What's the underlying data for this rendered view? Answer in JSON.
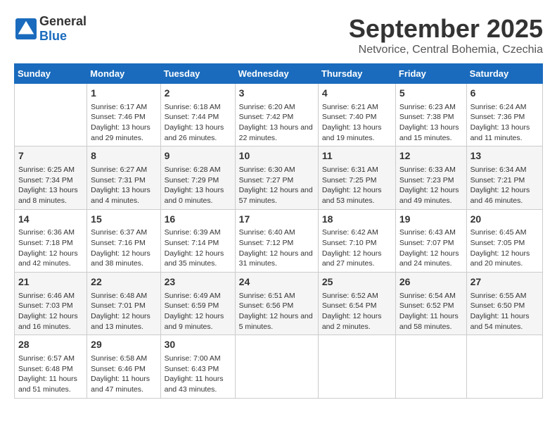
{
  "header": {
    "logo_general": "General",
    "logo_blue": "Blue",
    "month": "September 2025",
    "location": "Netvorice, Central Bohemia, Czechia"
  },
  "days_of_week": [
    "Sunday",
    "Monday",
    "Tuesday",
    "Wednesday",
    "Thursday",
    "Friday",
    "Saturday"
  ],
  "weeks": [
    [
      {
        "day": "",
        "sunrise": "",
        "sunset": "",
        "daylight": ""
      },
      {
        "day": "1",
        "sunrise": "Sunrise: 6:17 AM",
        "sunset": "Sunset: 7:46 PM",
        "daylight": "Daylight: 13 hours and 29 minutes."
      },
      {
        "day": "2",
        "sunrise": "Sunrise: 6:18 AM",
        "sunset": "Sunset: 7:44 PM",
        "daylight": "Daylight: 13 hours and 26 minutes."
      },
      {
        "day": "3",
        "sunrise": "Sunrise: 6:20 AM",
        "sunset": "Sunset: 7:42 PM",
        "daylight": "Daylight: 13 hours and 22 minutes."
      },
      {
        "day": "4",
        "sunrise": "Sunrise: 6:21 AM",
        "sunset": "Sunset: 7:40 PM",
        "daylight": "Daylight: 13 hours and 19 minutes."
      },
      {
        "day": "5",
        "sunrise": "Sunrise: 6:23 AM",
        "sunset": "Sunset: 7:38 PM",
        "daylight": "Daylight: 13 hours and 15 minutes."
      },
      {
        "day": "6",
        "sunrise": "Sunrise: 6:24 AM",
        "sunset": "Sunset: 7:36 PM",
        "daylight": "Daylight: 13 hours and 11 minutes."
      }
    ],
    [
      {
        "day": "7",
        "sunrise": "Sunrise: 6:25 AM",
        "sunset": "Sunset: 7:34 PM",
        "daylight": "Daylight: 13 hours and 8 minutes."
      },
      {
        "day": "8",
        "sunrise": "Sunrise: 6:27 AM",
        "sunset": "Sunset: 7:31 PM",
        "daylight": "Daylight: 13 hours and 4 minutes."
      },
      {
        "day": "9",
        "sunrise": "Sunrise: 6:28 AM",
        "sunset": "Sunset: 7:29 PM",
        "daylight": "Daylight: 13 hours and 0 minutes."
      },
      {
        "day": "10",
        "sunrise": "Sunrise: 6:30 AM",
        "sunset": "Sunset: 7:27 PM",
        "daylight": "Daylight: 12 hours and 57 minutes."
      },
      {
        "day": "11",
        "sunrise": "Sunrise: 6:31 AM",
        "sunset": "Sunset: 7:25 PM",
        "daylight": "Daylight: 12 hours and 53 minutes."
      },
      {
        "day": "12",
        "sunrise": "Sunrise: 6:33 AM",
        "sunset": "Sunset: 7:23 PM",
        "daylight": "Daylight: 12 hours and 49 minutes."
      },
      {
        "day": "13",
        "sunrise": "Sunrise: 6:34 AM",
        "sunset": "Sunset: 7:21 PM",
        "daylight": "Daylight: 12 hours and 46 minutes."
      }
    ],
    [
      {
        "day": "14",
        "sunrise": "Sunrise: 6:36 AM",
        "sunset": "Sunset: 7:18 PM",
        "daylight": "Daylight: 12 hours and 42 minutes."
      },
      {
        "day": "15",
        "sunrise": "Sunrise: 6:37 AM",
        "sunset": "Sunset: 7:16 PM",
        "daylight": "Daylight: 12 hours and 38 minutes."
      },
      {
        "day": "16",
        "sunrise": "Sunrise: 6:39 AM",
        "sunset": "Sunset: 7:14 PM",
        "daylight": "Daylight: 12 hours and 35 minutes."
      },
      {
        "day": "17",
        "sunrise": "Sunrise: 6:40 AM",
        "sunset": "Sunset: 7:12 PM",
        "daylight": "Daylight: 12 hours and 31 minutes."
      },
      {
        "day": "18",
        "sunrise": "Sunrise: 6:42 AM",
        "sunset": "Sunset: 7:10 PM",
        "daylight": "Daylight: 12 hours and 27 minutes."
      },
      {
        "day": "19",
        "sunrise": "Sunrise: 6:43 AM",
        "sunset": "Sunset: 7:07 PM",
        "daylight": "Daylight: 12 hours and 24 minutes."
      },
      {
        "day": "20",
        "sunrise": "Sunrise: 6:45 AM",
        "sunset": "Sunset: 7:05 PM",
        "daylight": "Daylight: 12 hours and 20 minutes."
      }
    ],
    [
      {
        "day": "21",
        "sunrise": "Sunrise: 6:46 AM",
        "sunset": "Sunset: 7:03 PM",
        "daylight": "Daylight: 12 hours and 16 minutes."
      },
      {
        "day": "22",
        "sunrise": "Sunrise: 6:48 AM",
        "sunset": "Sunset: 7:01 PM",
        "daylight": "Daylight: 12 hours and 13 minutes."
      },
      {
        "day": "23",
        "sunrise": "Sunrise: 6:49 AM",
        "sunset": "Sunset: 6:59 PM",
        "daylight": "Daylight: 12 hours and 9 minutes."
      },
      {
        "day": "24",
        "sunrise": "Sunrise: 6:51 AM",
        "sunset": "Sunset: 6:56 PM",
        "daylight": "Daylight: 12 hours and 5 minutes."
      },
      {
        "day": "25",
        "sunrise": "Sunrise: 6:52 AM",
        "sunset": "Sunset: 6:54 PM",
        "daylight": "Daylight: 12 hours and 2 minutes."
      },
      {
        "day": "26",
        "sunrise": "Sunrise: 6:54 AM",
        "sunset": "Sunset: 6:52 PM",
        "daylight": "Daylight: 11 hours and 58 minutes."
      },
      {
        "day": "27",
        "sunrise": "Sunrise: 6:55 AM",
        "sunset": "Sunset: 6:50 PM",
        "daylight": "Daylight: 11 hours and 54 minutes."
      }
    ],
    [
      {
        "day": "28",
        "sunrise": "Sunrise: 6:57 AM",
        "sunset": "Sunset: 6:48 PM",
        "daylight": "Daylight: 11 hours and 51 minutes."
      },
      {
        "day": "29",
        "sunrise": "Sunrise: 6:58 AM",
        "sunset": "Sunset: 6:46 PM",
        "daylight": "Daylight: 11 hours and 47 minutes."
      },
      {
        "day": "30",
        "sunrise": "Sunrise: 7:00 AM",
        "sunset": "Sunset: 6:43 PM",
        "daylight": "Daylight: 11 hours and 43 minutes."
      },
      {
        "day": "",
        "sunrise": "",
        "sunset": "",
        "daylight": ""
      },
      {
        "day": "",
        "sunrise": "",
        "sunset": "",
        "daylight": ""
      },
      {
        "day": "",
        "sunrise": "",
        "sunset": "",
        "daylight": ""
      },
      {
        "day": "",
        "sunrise": "",
        "sunset": "",
        "daylight": ""
      }
    ]
  ]
}
